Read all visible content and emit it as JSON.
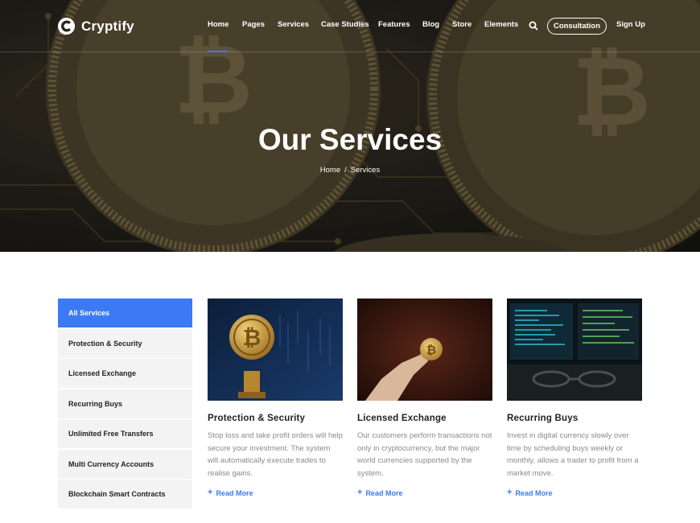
{
  "brand": {
    "name": "Cryptify"
  },
  "nav": {
    "items": [
      "Home",
      "Pages",
      "Services",
      "Case Studies",
      "Features",
      "Blog",
      "Store",
      "Elements"
    ],
    "search_icon": "search-icon",
    "consultation_label": "Consultation",
    "signup_label": "Sign Up"
  },
  "hero": {
    "title": "Our Services",
    "breadcrumb": {
      "home": "Home",
      "separator": "/",
      "current": "Services"
    }
  },
  "sidebar": {
    "items": [
      "All Services",
      "Protection & Security",
      "Licensed Exchange",
      "Recurring Buys",
      "Unlimited Free Transfers",
      "Multi Currency Accounts",
      "Blockchain Smart Contracts"
    ],
    "active_index": 0
  },
  "cards": [
    {
      "title": "Protection & Security",
      "desc": "Stop loss and take profit orders will help secure your investment. The system will automatically execute trades to realise gains.",
      "link": "Read More"
    },
    {
      "title": "Licensed Exchange",
      "desc": "Our customers perform transactions not only in cryptocurrency, but the major world currencies supported by the system.",
      "link": "Read More"
    },
    {
      "title": "Recurring Buys",
      "desc": "Invest in digital currency slowly over time by scheduling buys weekly or monthly, allows a trader to profit from a market move.",
      "link": "Read More"
    }
  ],
  "colors": {
    "accent": "#3c7af5",
    "sidebar_bg": "#f3f3f3",
    "text_muted": "#8a8a8a"
  }
}
